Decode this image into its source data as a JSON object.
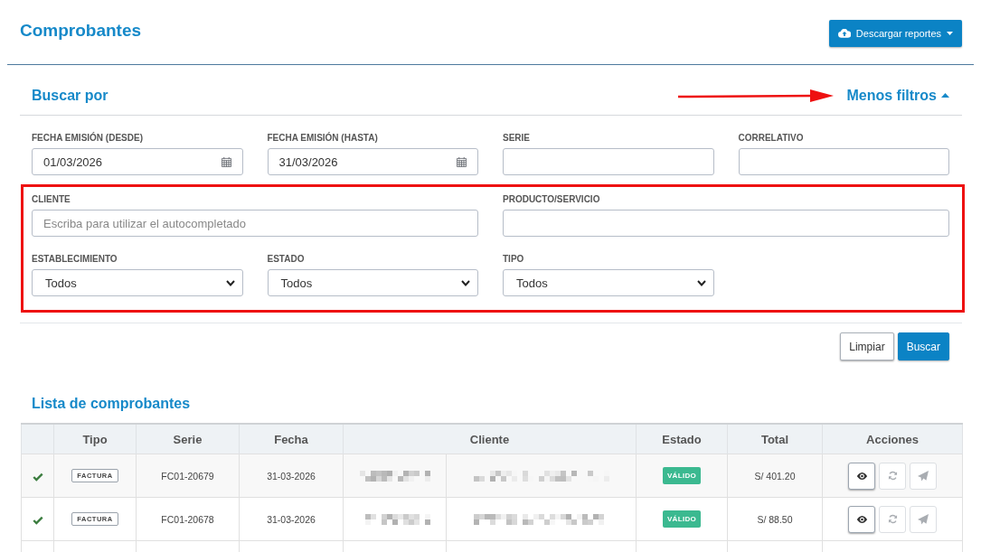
{
  "page": {
    "title": "Comprobantes",
    "download_button": {
      "label": "Descargar reportes"
    }
  },
  "annotations": {
    "frame_around_extra_filters": true,
    "arrow_to_toggle": true
  },
  "filters": {
    "title": "Buscar por",
    "toggle": {
      "label": "Menos filtros",
      "expanded": true
    },
    "fields": [
      [
        {
          "label": "FECHA EMISIÓN (DESDE)",
          "kind": "date",
          "value": "01/03/2026"
        },
        {
          "label": "FECHA EMISIÓN (HASTA)",
          "kind": "date",
          "value": "31/03/2026"
        },
        {
          "label": "SERIE",
          "kind": "text"
        },
        {
          "label": "CORRELATIVO",
          "kind": "text"
        }
      ]
    ],
    "extra_fields": [
      [
        {
          "label": "CLIENTE",
          "kind": "text",
          "placeholder": "Escriba para utilizar el autocompletado"
        },
        {
          "label": "PRODUCTO/SERVICIO",
          "kind": "text"
        }
      ],
      [
        {
          "label": "ESTABLECIMIENTO",
          "kind": "select",
          "value": "Todos"
        },
        {
          "label": "ESTADO",
          "kind": "select",
          "value": "Todos"
        },
        {
          "label": "TIPO",
          "kind": "select",
          "value": "Todos"
        }
      ]
    ],
    "buttons": [
      {
        "label": "Limpiar",
        "kind": "default"
      },
      {
        "label": "Buscar",
        "kind": "primary"
      }
    ]
  },
  "list": {
    "title": "Lista de comprobantes",
    "columns": [
      {
        "label": "Tipo"
      },
      {
        "label": "Serie"
      },
      {
        "label": "Fecha"
      },
      {
        "label": "Cliente",
        "split": true
      },
      {
        "label": "Estado"
      },
      {
        "label": "Total"
      },
      {
        "label": "Acciones"
      }
    ],
    "rows": [
      {
        "verified": true,
        "tipo": "FACTURA",
        "serie": "FC01-20679",
        "fecha": "31-03-2026",
        "cliente_pixelated": true,
        "estado": "VÁLIDO",
        "total": "S/ 401.20",
        "actions": [
          {
            "kind": "view",
            "disabled": false
          },
          {
            "kind": "refresh",
            "disabled": true
          },
          {
            "kind": "send",
            "disabled": true
          }
        ]
      },
      {
        "verified": true,
        "tipo": "FACTURA",
        "serie": "FC01-20678",
        "fecha": "31-03-2026",
        "cliente_pixelated": true,
        "estado": "VÁLIDO",
        "total": "S/ 88.50",
        "actions": [
          {
            "kind": "view",
            "disabled": false
          },
          {
            "kind": "refresh",
            "disabled": true
          },
          {
            "kind": "send",
            "disabled": true
          }
        ]
      }
    ]
  }
}
